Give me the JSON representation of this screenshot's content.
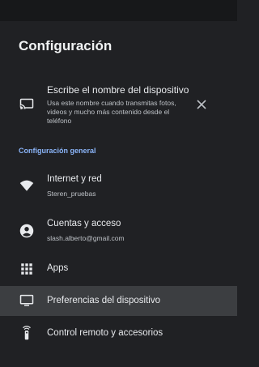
{
  "title": "Configuración",
  "notice": {
    "heading": "Escribe el nombre del dispositivo",
    "description": "Usa este nombre cuando transmitas fotos, videos y mucho más contenido desde el teléfono"
  },
  "section_label": "Configuración general",
  "items": [
    {
      "label": "Internet y red",
      "sub": "Steren_pruebas",
      "icon": "wifi-icon"
    },
    {
      "label": "Cuentas y acceso",
      "sub": "slash.alberto@gmail.com",
      "icon": "account-icon"
    },
    {
      "label": "Apps",
      "icon": "apps-grid-icon"
    },
    {
      "label": "Preferencias del dispositivo",
      "icon": "tv-icon",
      "selected": true
    },
    {
      "label": "Control remoto y accesorios",
      "icon": "remote-icon"
    }
  ],
  "colors": {
    "background": "#202124",
    "accent": "#8ab4f8",
    "selected_row": "#3c3e41",
    "text": "#e8eaed",
    "secondary_text": "#bdc1c6"
  }
}
